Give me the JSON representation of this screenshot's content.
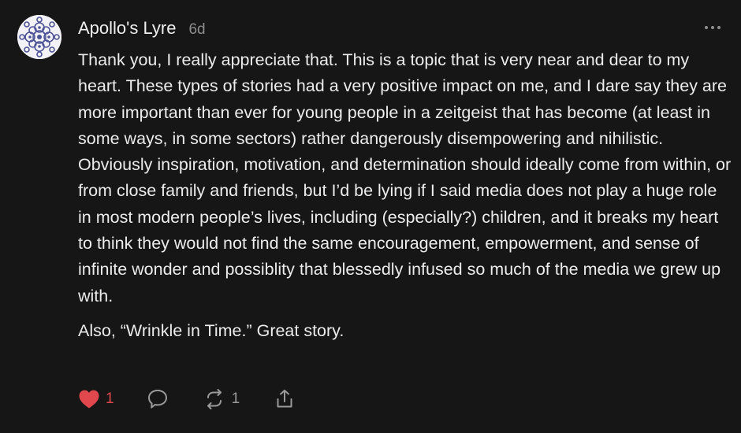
{
  "comment": {
    "author": "Apollo's Lyre",
    "timestamp": "6d",
    "avatar_icon": "patterned-mandala-avatar",
    "paragraphs": [
      "Thank you, I really appreciate that. This is a topic that is very near and dear to my heart. These types of stories had a very positive impact on me, and I dare say they are more important than ever for young people in a zeitgeist that has become (at least in some ways, in some sectors) rather dangerously disempowering and nihilistic. Obviously inspiration, motivation, and determination should ideally come from within, or from close family and friends, but I’d be lying if I said media does not play a huge role in most modern people’s lives, including (especially?) children, and it breaks my heart to think they would not find the same encouragement, empowerment, and sense of infinite wonder and possiblity that blessedly infused so much of the media we grew up with.",
      "Also, “Wrinkle in Time.” Great story."
    ]
  },
  "actions": {
    "like_count": "1",
    "restack_count": "1",
    "like_icon": "heart-icon",
    "reply_icon": "comment-bubble-icon",
    "restack_icon": "restack-icon",
    "share_icon": "share-icon",
    "more_icon": "more-dots-icon"
  },
  "colors": {
    "background": "#161616",
    "text": "#ececec",
    "muted": "#8e8e8e",
    "like": "#e0484d"
  }
}
